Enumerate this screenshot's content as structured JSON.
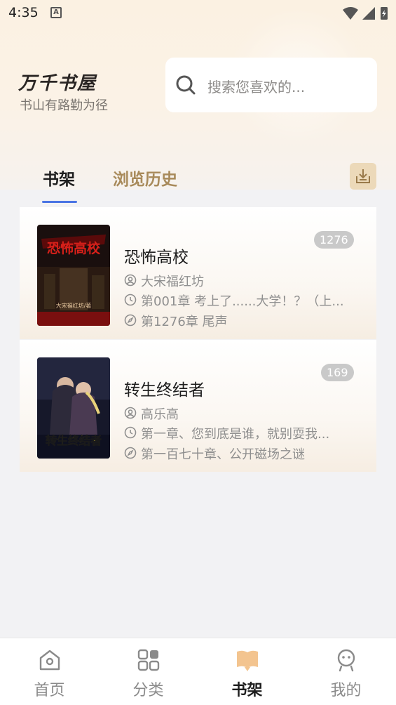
{
  "status": {
    "time": "4:35",
    "indicator": "A"
  },
  "app": {
    "title": "万千书屋",
    "slogan": "书山有路勤为径"
  },
  "search": {
    "placeholder": "搜索您喜欢的..."
  },
  "tabs": [
    {
      "label": "书架",
      "active": true
    },
    {
      "label": "浏览历史",
      "active": false
    }
  ],
  "books": [
    {
      "title": "恐怖高校",
      "badge": "1276",
      "author": "大宋福红坊",
      "last_read": "第001章 考上了......大学！？（上...",
      "latest": "第1276章 尾声",
      "cover_text": "恐怖高校",
      "cover_author": "大宋福红坊/著"
    },
    {
      "title": "转生终结者",
      "badge": "169",
      "author": "高乐高",
      "last_read": "第一章、您到底是谁，就别耍我...",
      "latest": "第一百七十章、公开磁场之谜",
      "cover_text": "转生终结者"
    }
  ],
  "nav": [
    {
      "label": "首页",
      "icon": "home-icon"
    },
    {
      "label": "分类",
      "icon": "category-icon"
    },
    {
      "label": "书架",
      "icon": "bookshelf-icon",
      "active": true
    },
    {
      "label": "我的",
      "icon": "profile-icon"
    }
  ],
  "colors": {
    "accent_blue": "#4a74e4",
    "tab_gold": "#a88a5a",
    "active_nav": "#f3c48f"
  }
}
